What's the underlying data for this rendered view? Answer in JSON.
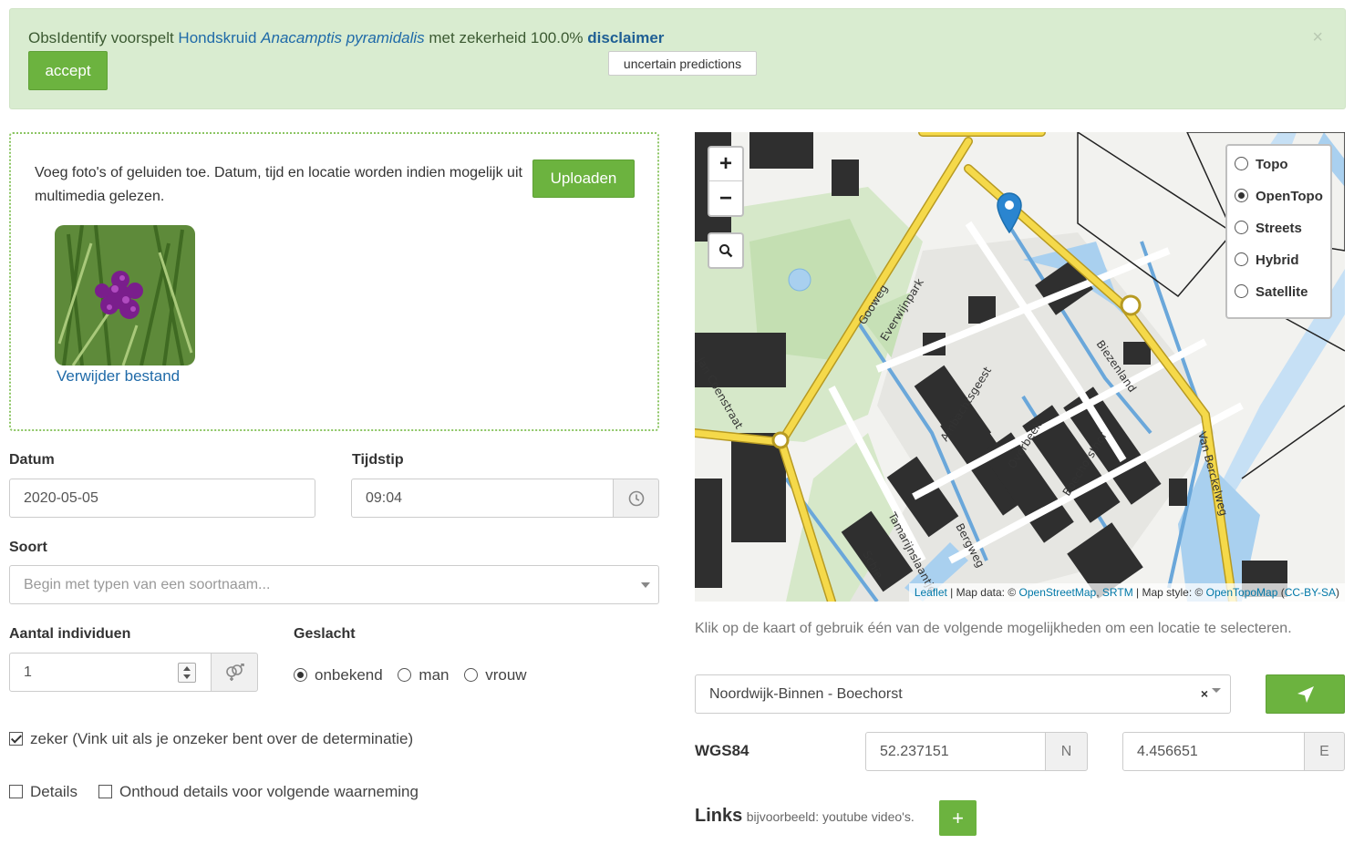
{
  "banner": {
    "prefix": "ObsIdentify voorspelt ",
    "species_common": "Hondskruid",
    "species_latin": "Anacamptis pyramidalis",
    "middle": " met zekerheid 100.0% ",
    "disclaimer": "disclaimer",
    "accept_label": "accept",
    "uncertain_label": "uncertain predictions",
    "close_symbol": "×"
  },
  "upload": {
    "instruction": "Voeg foto's of geluiden toe. Datum, tijd en locatie worden indien mogelijk uit multimedia gelezen.",
    "upload_label": "Uploaden",
    "remove_label": "Verwijder bestand"
  },
  "form": {
    "datum_label": "Datum",
    "datum_value": "2020-05-05",
    "tijd_label": "Tijdstip",
    "tijd_value": "09:04",
    "soort_label": "Soort",
    "soort_placeholder": "Begin met typen van een soortnaam...",
    "aantal_label": "Aantal individuen",
    "aantal_value": "1",
    "geslacht_label": "Geslacht",
    "geslacht_options": [
      "onbekend",
      "man",
      "vrouw"
    ],
    "geslacht_selected": "onbekend",
    "zeker_label": "zeker (Vink uit als je onzeker bent over de determinatie)",
    "zeker_checked": true,
    "details_label": "Details",
    "onthoud_label": "Onthoud details voor volgende waarneming"
  },
  "map": {
    "zoom_in": "+",
    "zoom_out": "−",
    "layers": [
      "Topo",
      "OpenTopo",
      "Streets",
      "Hybrid",
      "Satellite"
    ],
    "layer_selected": "OpenTopo",
    "streets": [
      "Everwijnpark",
      "Gooweg",
      "Ambachtsgeest",
      "Biezenland",
      "Overbeek",
      "Boechorsthof",
      "Van Berckelweg",
      "Jan Coenstraat",
      "Tamarijnslaantje",
      "Bergweg",
      "Schie"
    ],
    "attribution": {
      "leaflet": "Leaflet",
      "data_prefix": " | Map data: © ",
      "osm": "OpenStreetMap",
      "sep": ", ",
      "srtm": "SRTM",
      "style_prefix": " | Map style: © ",
      "opentopo": "OpenTopoMap",
      "license_open": " (",
      "license": "CC-BY-SA",
      "license_close": ")"
    }
  },
  "location": {
    "help": "Klik op de kaart of gebruik één van de volgende mogelijkheden om een locatie te selecteren.",
    "selected": "Noordwijk-Binnen - Boechorst",
    "clear_symbol": "×",
    "wgs_label": "WGS84",
    "lat": "52.237151",
    "lat_unit": "N",
    "lon": "4.456651",
    "lon_unit": "E"
  },
  "links": {
    "title": "Links",
    "hint": "bijvoorbeeld: youtube video's.",
    "add_symbol": "+"
  },
  "colors": {
    "accent_green": "#6cb33f",
    "banner_bg": "#d9ecd0",
    "link_blue": "#1f6aa8"
  }
}
